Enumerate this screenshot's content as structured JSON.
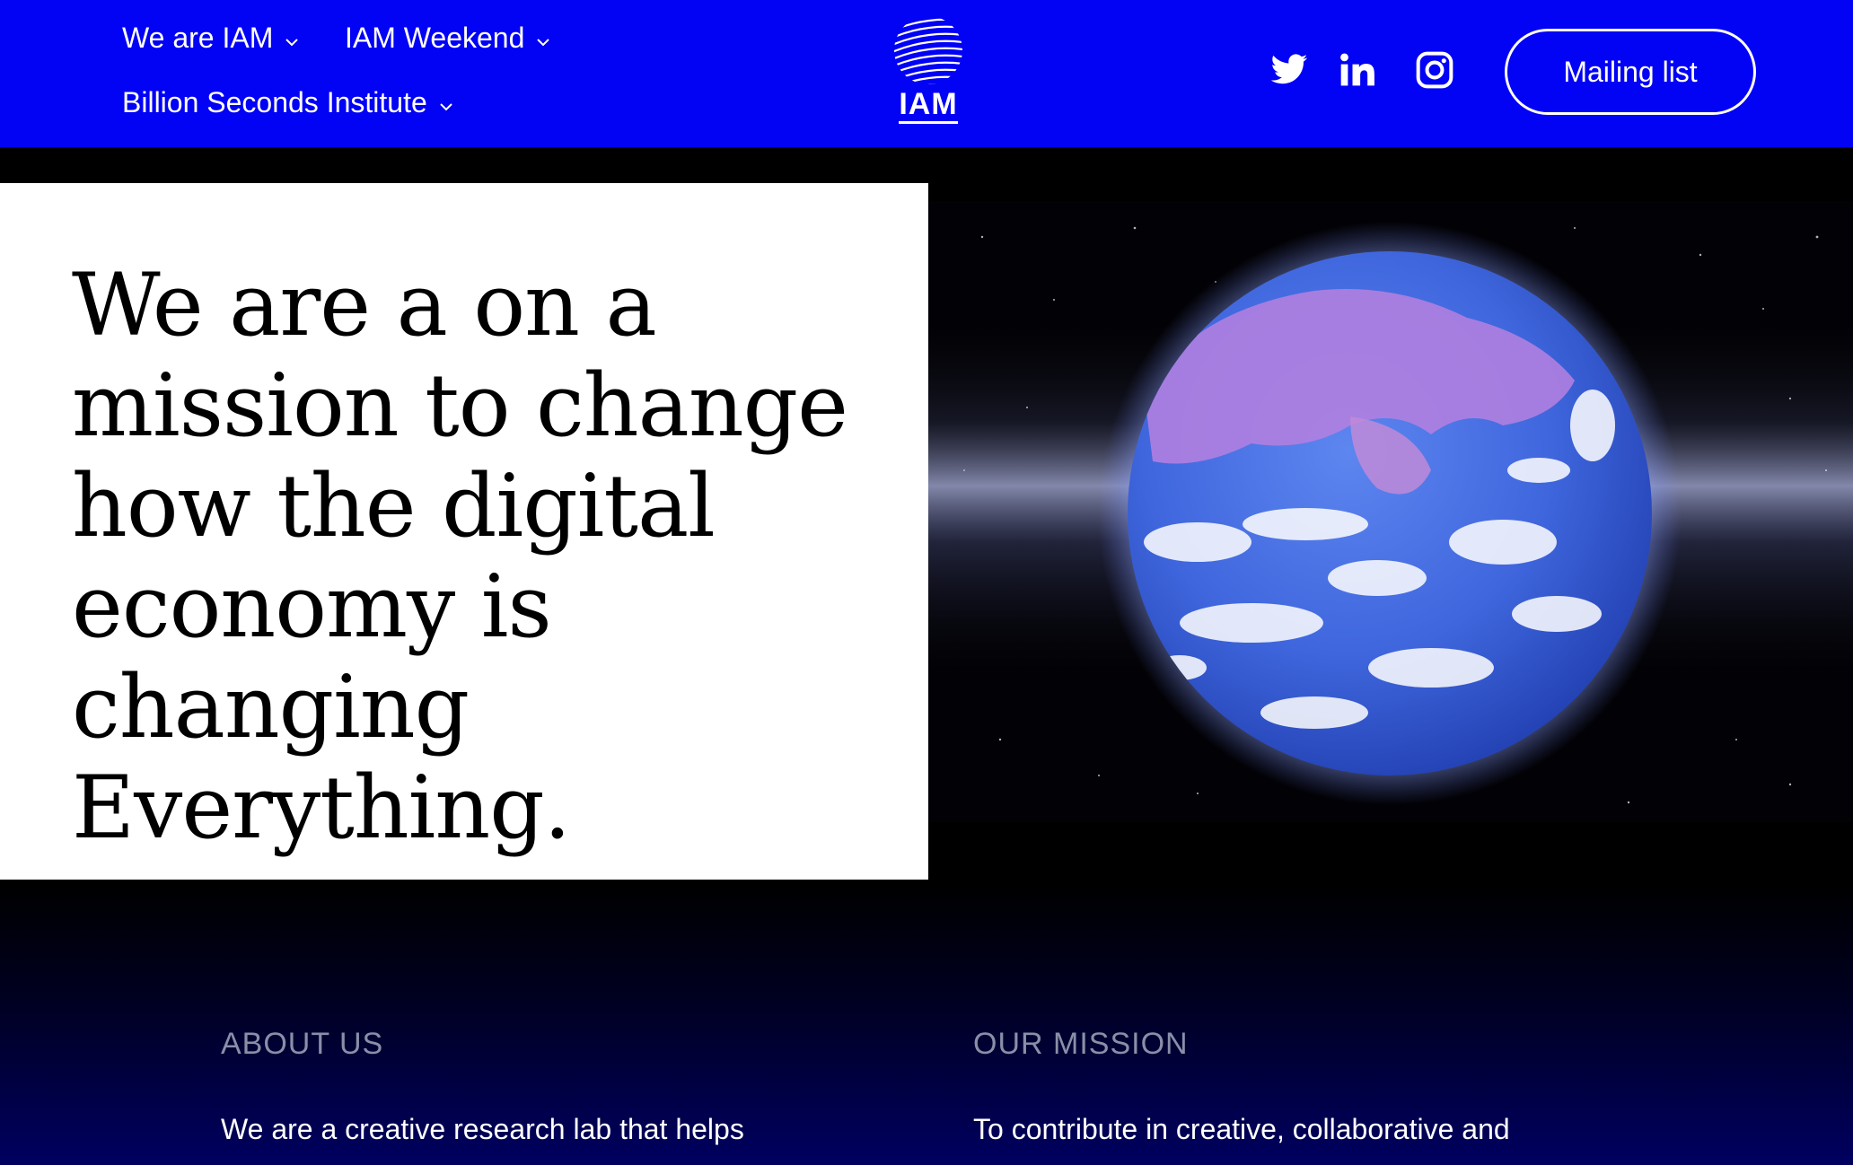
{
  "header": {
    "nav": [
      {
        "label": "We are IAM"
      },
      {
        "label": "IAM Weekend"
      },
      {
        "label": "Billion Seconds Institute"
      }
    ],
    "logo_text": "IAM",
    "social_icons": [
      "twitter-icon",
      "linkedin-icon",
      "instagram-icon"
    ],
    "mailing_label": "Mailing list",
    "background_color": "#0202f5"
  },
  "hero": {
    "headline": "We are a on a mission to change how the digital economy is changing Everything."
  },
  "about": {
    "heading": "ABOUT US",
    "text": "We are a creative research lab that helps"
  },
  "mission": {
    "heading": "OUR MISSION",
    "text": "To contribute in creative, collaborative and"
  }
}
